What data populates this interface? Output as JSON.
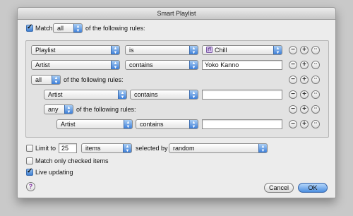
{
  "window": {
    "title": "Smart Playlist"
  },
  "match": {
    "checked": true,
    "label": "Match",
    "quantifier": "all",
    "suffix": "of the following rules:"
  },
  "rules": [
    {
      "field": "Playlist",
      "op": "is",
      "value": "Chill",
      "value_type": "popup"
    },
    {
      "field": "Artist",
      "op": "contains",
      "value": "Yoko Kanno",
      "value_type": "text"
    },
    {
      "group_quantifier": "all",
      "group_suffix": "of the following rules:"
    },
    {
      "field": "Artist",
      "op": "contains",
      "value": "",
      "value_type": "text"
    },
    {
      "group_quantifier": "any",
      "group_suffix": "of the following rules:"
    },
    {
      "field": "Artist",
      "op": "contains",
      "value": "",
      "value_type": "text"
    }
  ],
  "row_buttons": {
    "remove": "−",
    "add": "+",
    "more": "···"
  },
  "limit": {
    "checked": false,
    "label": "Limit to",
    "value": "25",
    "unit": "items",
    "selected_by_label": "selected by",
    "selected_by": "random"
  },
  "match_checked": {
    "checked": false,
    "label": "Match only checked items"
  },
  "live_updating": {
    "checked": true,
    "label": "Live updating"
  },
  "buttons": {
    "help": "?",
    "cancel": "Cancel",
    "ok": "OK"
  },
  "colors": {
    "accent": "#3c7ed8",
    "window_bg": "#ececec",
    "rules_bg": "#e2e2e2"
  }
}
